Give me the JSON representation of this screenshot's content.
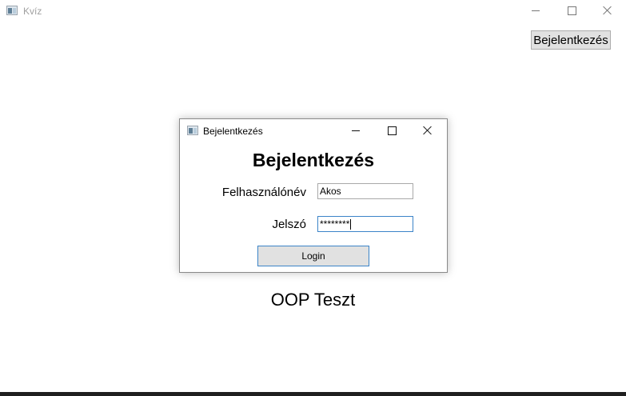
{
  "main_window": {
    "title": "Kvíz",
    "icon": "app-window-icon",
    "caption_buttons": [
      "minimize-icon",
      "maximize-icon",
      "close-icon"
    ],
    "login_button_label": "Bejelentkezés",
    "caption_text": "OOP Teszt"
  },
  "dialog": {
    "title": "Bejelentkezés",
    "icon": "app-window-icon",
    "heading": "Bejelentkezés",
    "username_label": "Felhasználónév",
    "username_value": "Akos",
    "password_label": "Jelszó",
    "password_value": "********",
    "login_button_label": "Login"
  },
  "colors": {
    "focus_border": "#3c84c8",
    "button_background": "#e1e1e1",
    "taskbar": "#1f1f1f"
  }
}
